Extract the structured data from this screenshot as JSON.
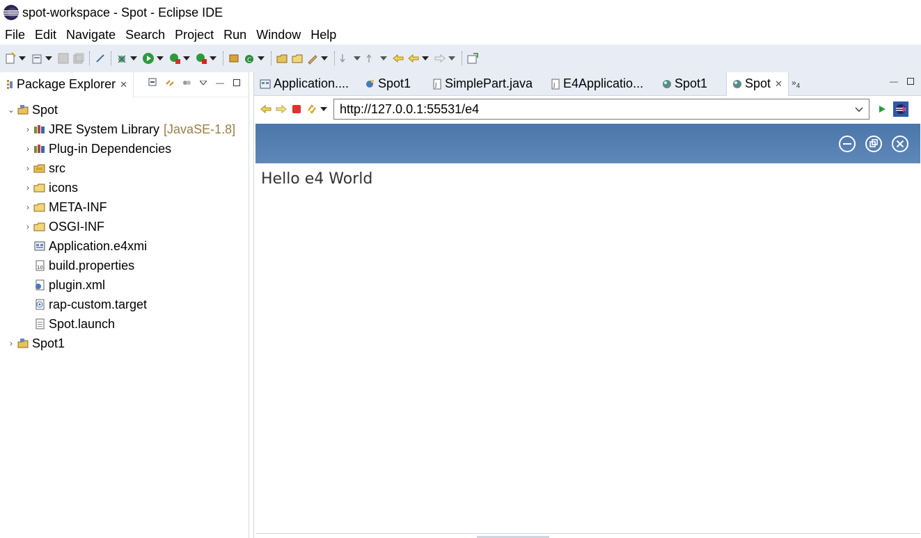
{
  "window": {
    "title": "spot-workspace - Spot - Eclipse IDE"
  },
  "menu": [
    "File",
    "Edit",
    "Navigate",
    "Search",
    "Project",
    "Run",
    "Window",
    "Help"
  ],
  "package_explorer": {
    "tab_label": "Package Explorer",
    "tree": [
      {
        "label": "Spot",
        "expanded": true,
        "level": 0,
        "icon": "project-icon"
      },
      {
        "label": "JRE System Library",
        "decoration": "[JavaSE-1.8]",
        "level": 1,
        "icon": "library-icon"
      },
      {
        "label": "Plug-in Dependencies",
        "level": 1,
        "icon": "library-icon"
      },
      {
        "label": "src",
        "level": 1,
        "icon": "source-folder-icon"
      },
      {
        "label": "icons",
        "level": 1,
        "icon": "folder-icon"
      },
      {
        "label": "META-INF",
        "level": 1,
        "icon": "folder-icon"
      },
      {
        "label": "OSGI-INF",
        "level": 1,
        "icon": "folder-icon"
      },
      {
        "label": "Application.e4xmi",
        "level": 1,
        "icon": "e4xmi-file-icon",
        "leaf": true
      },
      {
        "label": "build.properties",
        "level": 1,
        "icon": "properties-file-icon",
        "leaf": true
      },
      {
        "label": "plugin.xml",
        "level": 1,
        "icon": "plugin-file-icon",
        "leaf": true
      },
      {
        "label": "rap-custom.target",
        "level": 1,
        "icon": "target-file-icon",
        "leaf": true
      },
      {
        "label": "Spot.launch",
        "level": 1,
        "icon": "launch-file-icon",
        "leaf": true
      },
      {
        "label": "Spot1",
        "level": 0,
        "icon": "project-icon"
      }
    ]
  },
  "editor": {
    "tabs": [
      {
        "label": "Application....",
        "icon": "e4xmi-file-icon"
      },
      {
        "label": "Spot1",
        "icon": "plugin-file-icon"
      },
      {
        "label": "SimplePart.java",
        "icon": "java-file-icon"
      },
      {
        "label": "E4Applicatio...",
        "icon": "java-file-icon"
      },
      {
        "label": "Spot1",
        "icon": "browser-globe-icon"
      },
      {
        "label": "Spot",
        "icon": "browser-globe-icon",
        "active": true
      }
    ],
    "overflow_count": "4",
    "url": "http://127.0.0.1:55531/e4",
    "content_text": "Hello e4 World"
  },
  "colors": {
    "header_blue": "#5580b2",
    "toolbar_bg": "#e8edf5",
    "decoration": "#9a7d46"
  }
}
